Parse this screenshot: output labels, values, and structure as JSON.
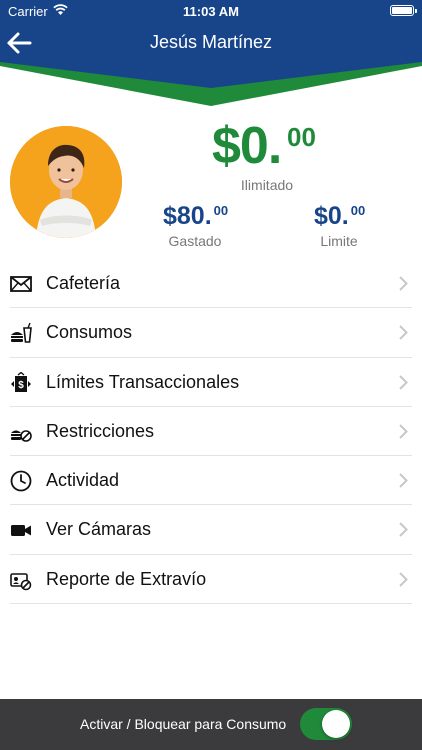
{
  "status_bar": {
    "carrier": "Carrier",
    "time": "11:03 AM"
  },
  "header": {
    "title": "Jesús Martínez",
    "back_icon": "arrow-left-icon",
    "bg_color": "#18458a",
    "accent_color": "#1f8a3a"
  },
  "balance": {
    "main": "$0.",
    "cents": "00",
    "label": "Ilimitado",
    "color": "#1f8a3a"
  },
  "stats": {
    "spent": {
      "main": "$80.",
      "cents": "00",
      "label": "Gastado"
    },
    "limit": {
      "main": "$0.",
      "cents": "00",
      "label": "Limite"
    }
  },
  "menu": {
    "items": [
      {
        "label": "Cafetería",
        "icon": "envelope-icon"
      },
      {
        "label": "Consumos",
        "icon": "food-drink-icon"
      },
      {
        "label": "Límites Transaccionales",
        "icon": "money-limit-icon"
      },
      {
        "label": "Restricciones",
        "icon": "food-blocked-icon"
      },
      {
        "label": "Actividad",
        "icon": "clock-icon"
      },
      {
        "label": "Ver Cámaras",
        "icon": "video-camera-icon"
      },
      {
        "label": "Reporte de Extravío",
        "icon": "card-blocked-icon"
      }
    ]
  },
  "bottom_bar": {
    "label": "Activar / Bloquear para Consumo",
    "toggle_on": true
  }
}
